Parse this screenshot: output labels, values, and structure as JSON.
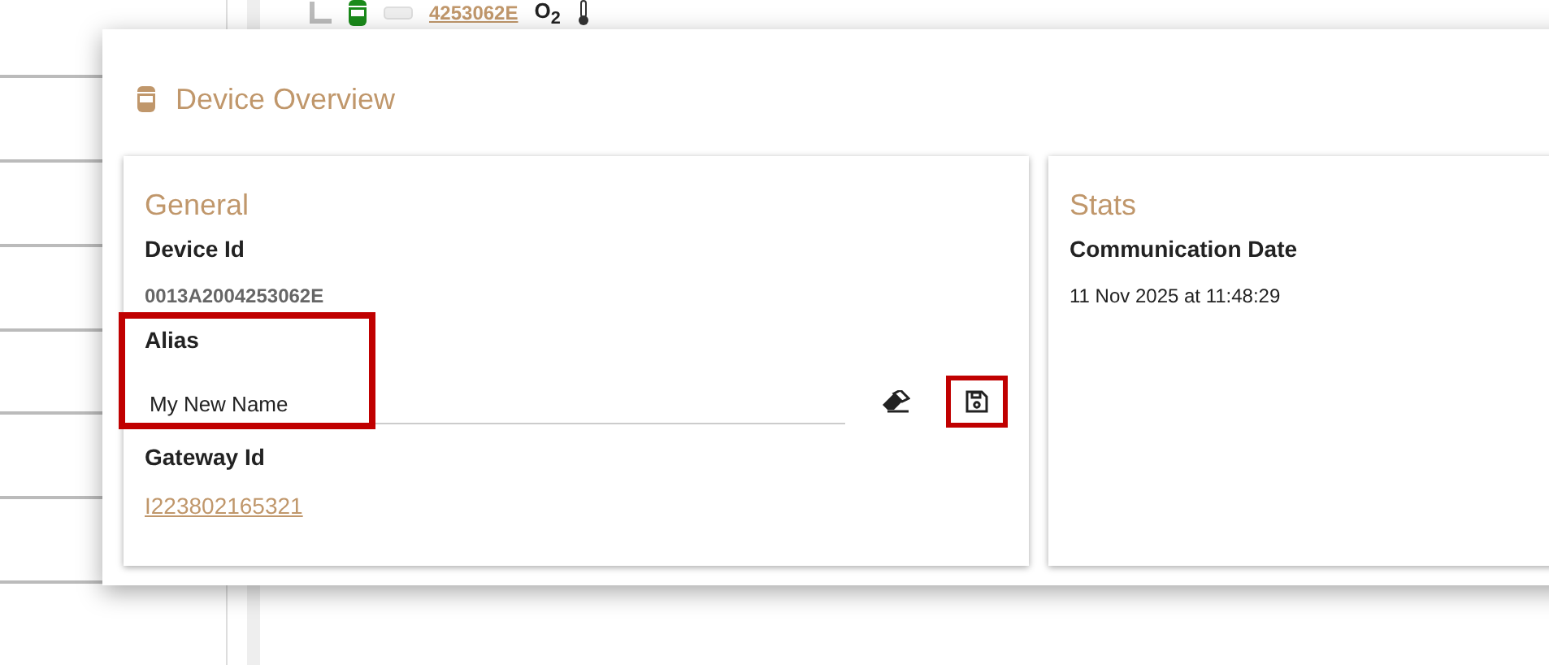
{
  "tree_row": {
    "link": "4253062E",
    "sensor": "O$_{2}$"
  },
  "dialog": {
    "title": "Device Overview",
    "cards": [
      {
        "title": "General",
        "fields": [
          {
            "kind": "code",
            "label": "Device Id",
            "value": "0013A2004253062E"
          },
          {
            "kind": "input",
            "label": "Alias",
            "value": "My New Name",
            "highlighted": true,
            "actions": [
              {
                "kind": "clear",
                "highlighted": false
              },
              {
                "kind": "save",
                "highlighted": true
              }
            ]
          },
          {
            "kind": "link",
            "label": "Gateway Id",
            "value": "I223802165321"
          }
        ]
      },
      {
        "title": "Stats",
        "fields": [
          {
            "kind": "text",
            "label": "Communication Date",
            "value": "11 Nov 2025 at 11:48:29"
          }
        ]
      }
    ]
  }
}
